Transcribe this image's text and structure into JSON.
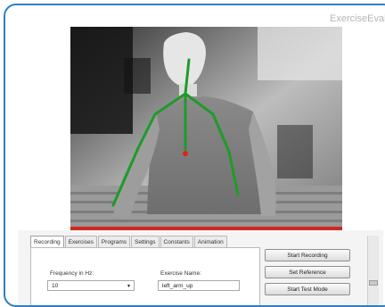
{
  "window": {
    "title": "ExerciseEvaluat"
  },
  "tabs": [
    "Recording",
    "Exercises",
    "Programs",
    "Settings",
    "Constants",
    "Animation"
  ],
  "recording_panel": {
    "frequency_label": "Frequency in Hz:",
    "frequency_value": "10",
    "exercise_name_label": "Exercise Name:",
    "exercise_name_value": "left_arm_up"
  },
  "buttons": {
    "start_recording": "Start Recording",
    "set_reference": "Set Reference",
    "start_test_mode": "Start Test Mode"
  },
  "colors": {
    "window_border": "#2f7fc3",
    "skeleton": "#1e9b2a",
    "center_marker": "#e02020",
    "status_bar": "#d0281e"
  }
}
